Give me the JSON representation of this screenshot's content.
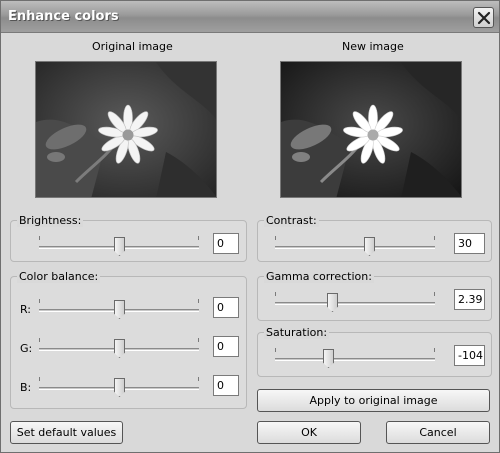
{
  "window": {
    "title": "Enhance colors"
  },
  "images": {
    "original_label": "Original image",
    "new_label": "New image"
  },
  "brightness": {
    "label": "Brightness:",
    "value": "0",
    "level": 0.5
  },
  "color_balance": {
    "label": "Color balance:",
    "channels": [
      {
        "label": "R:",
        "value": "0",
        "level": 0.5
      },
      {
        "label": "G:",
        "value": "0",
        "level": 0.5
      },
      {
        "label": "B:",
        "value": "0",
        "level": 0.5
      }
    ]
  },
  "contrast": {
    "label": "Contrast:",
    "value": "30",
    "level": 0.6
  },
  "gamma": {
    "label": "Gamma correction:",
    "value": "2.39",
    "level": 0.35
  },
  "saturation": {
    "label": "Saturation:",
    "value": "-104",
    "level": 0.32
  },
  "buttons": {
    "apply": "Apply to original image",
    "defaults": "Set default values",
    "ok": "OK",
    "cancel": "Cancel"
  },
  "icons": {
    "close": "close-icon",
    "slider_thumb": "slider-thumb"
  }
}
